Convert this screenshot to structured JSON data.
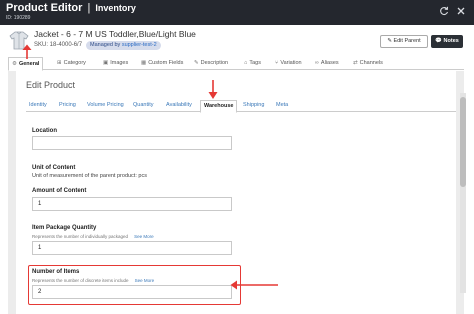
{
  "window": {
    "title": "Product Editor",
    "title_separator": "|",
    "module": "Inventory",
    "record_id": "ID: 190289"
  },
  "product": {
    "name": "Jacket - 6 - 7 M US Toddler,Blue/Light Blue",
    "sku": "SKU: 18-4000-6/7",
    "managed_prefix": "Managed by",
    "managed_supplier": "supplier-test-2",
    "edit_parent_label": "Edit Parent",
    "notes_label": "Notes"
  },
  "main_tabs": [
    {
      "label": "General",
      "icon": "gears-icon",
      "active": true
    },
    {
      "label": "Category",
      "icon": "category-icon"
    },
    {
      "label": "Images",
      "icon": "images-icon"
    },
    {
      "label": "Custom Fields",
      "icon": "grid-icon"
    },
    {
      "label": "Description",
      "icon": "edit-icon"
    },
    {
      "label": "Tags",
      "icon": "tag-icon"
    },
    {
      "label": "Variation",
      "icon": "branch-icon"
    },
    {
      "label": "Aliases",
      "icon": "link-icon"
    },
    {
      "label": "Channels",
      "icon": "share-icon"
    }
  ],
  "edit_product": {
    "title": "Edit Product",
    "sub_tabs": [
      {
        "label": "Identity"
      },
      {
        "label": "Pricing"
      },
      {
        "label": "Volume Pricing"
      },
      {
        "label": "Quantity"
      },
      {
        "label": "Availability"
      },
      {
        "label": "Warehouse",
        "active": true
      },
      {
        "label": "Shipping"
      },
      {
        "label": "Meta"
      }
    ]
  },
  "fields": {
    "location": {
      "label": "Location",
      "value": ""
    },
    "unit_of_content": {
      "label": "Unit of Content",
      "text": "Unit of measurement of the parent product: pcs"
    },
    "amount_of_content": {
      "label": "Amount of Content",
      "value": "1"
    },
    "item_package_quantity": {
      "label": "Item Package Quantity",
      "description": "Represents the number of individually packaged",
      "see_more": "See More",
      "value": "1"
    },
    "number_of_items": {
      "label": "Number of Items",
      "description": "Represents the number of discrete items include",
      "see_more": "See More",
      "value": "2"
    }
  },
  "colors": {
    "titlebar": "#24272e",
    "annotation_red": "#e53935",
    "link_blue": "#3a78b8"
  }
}
